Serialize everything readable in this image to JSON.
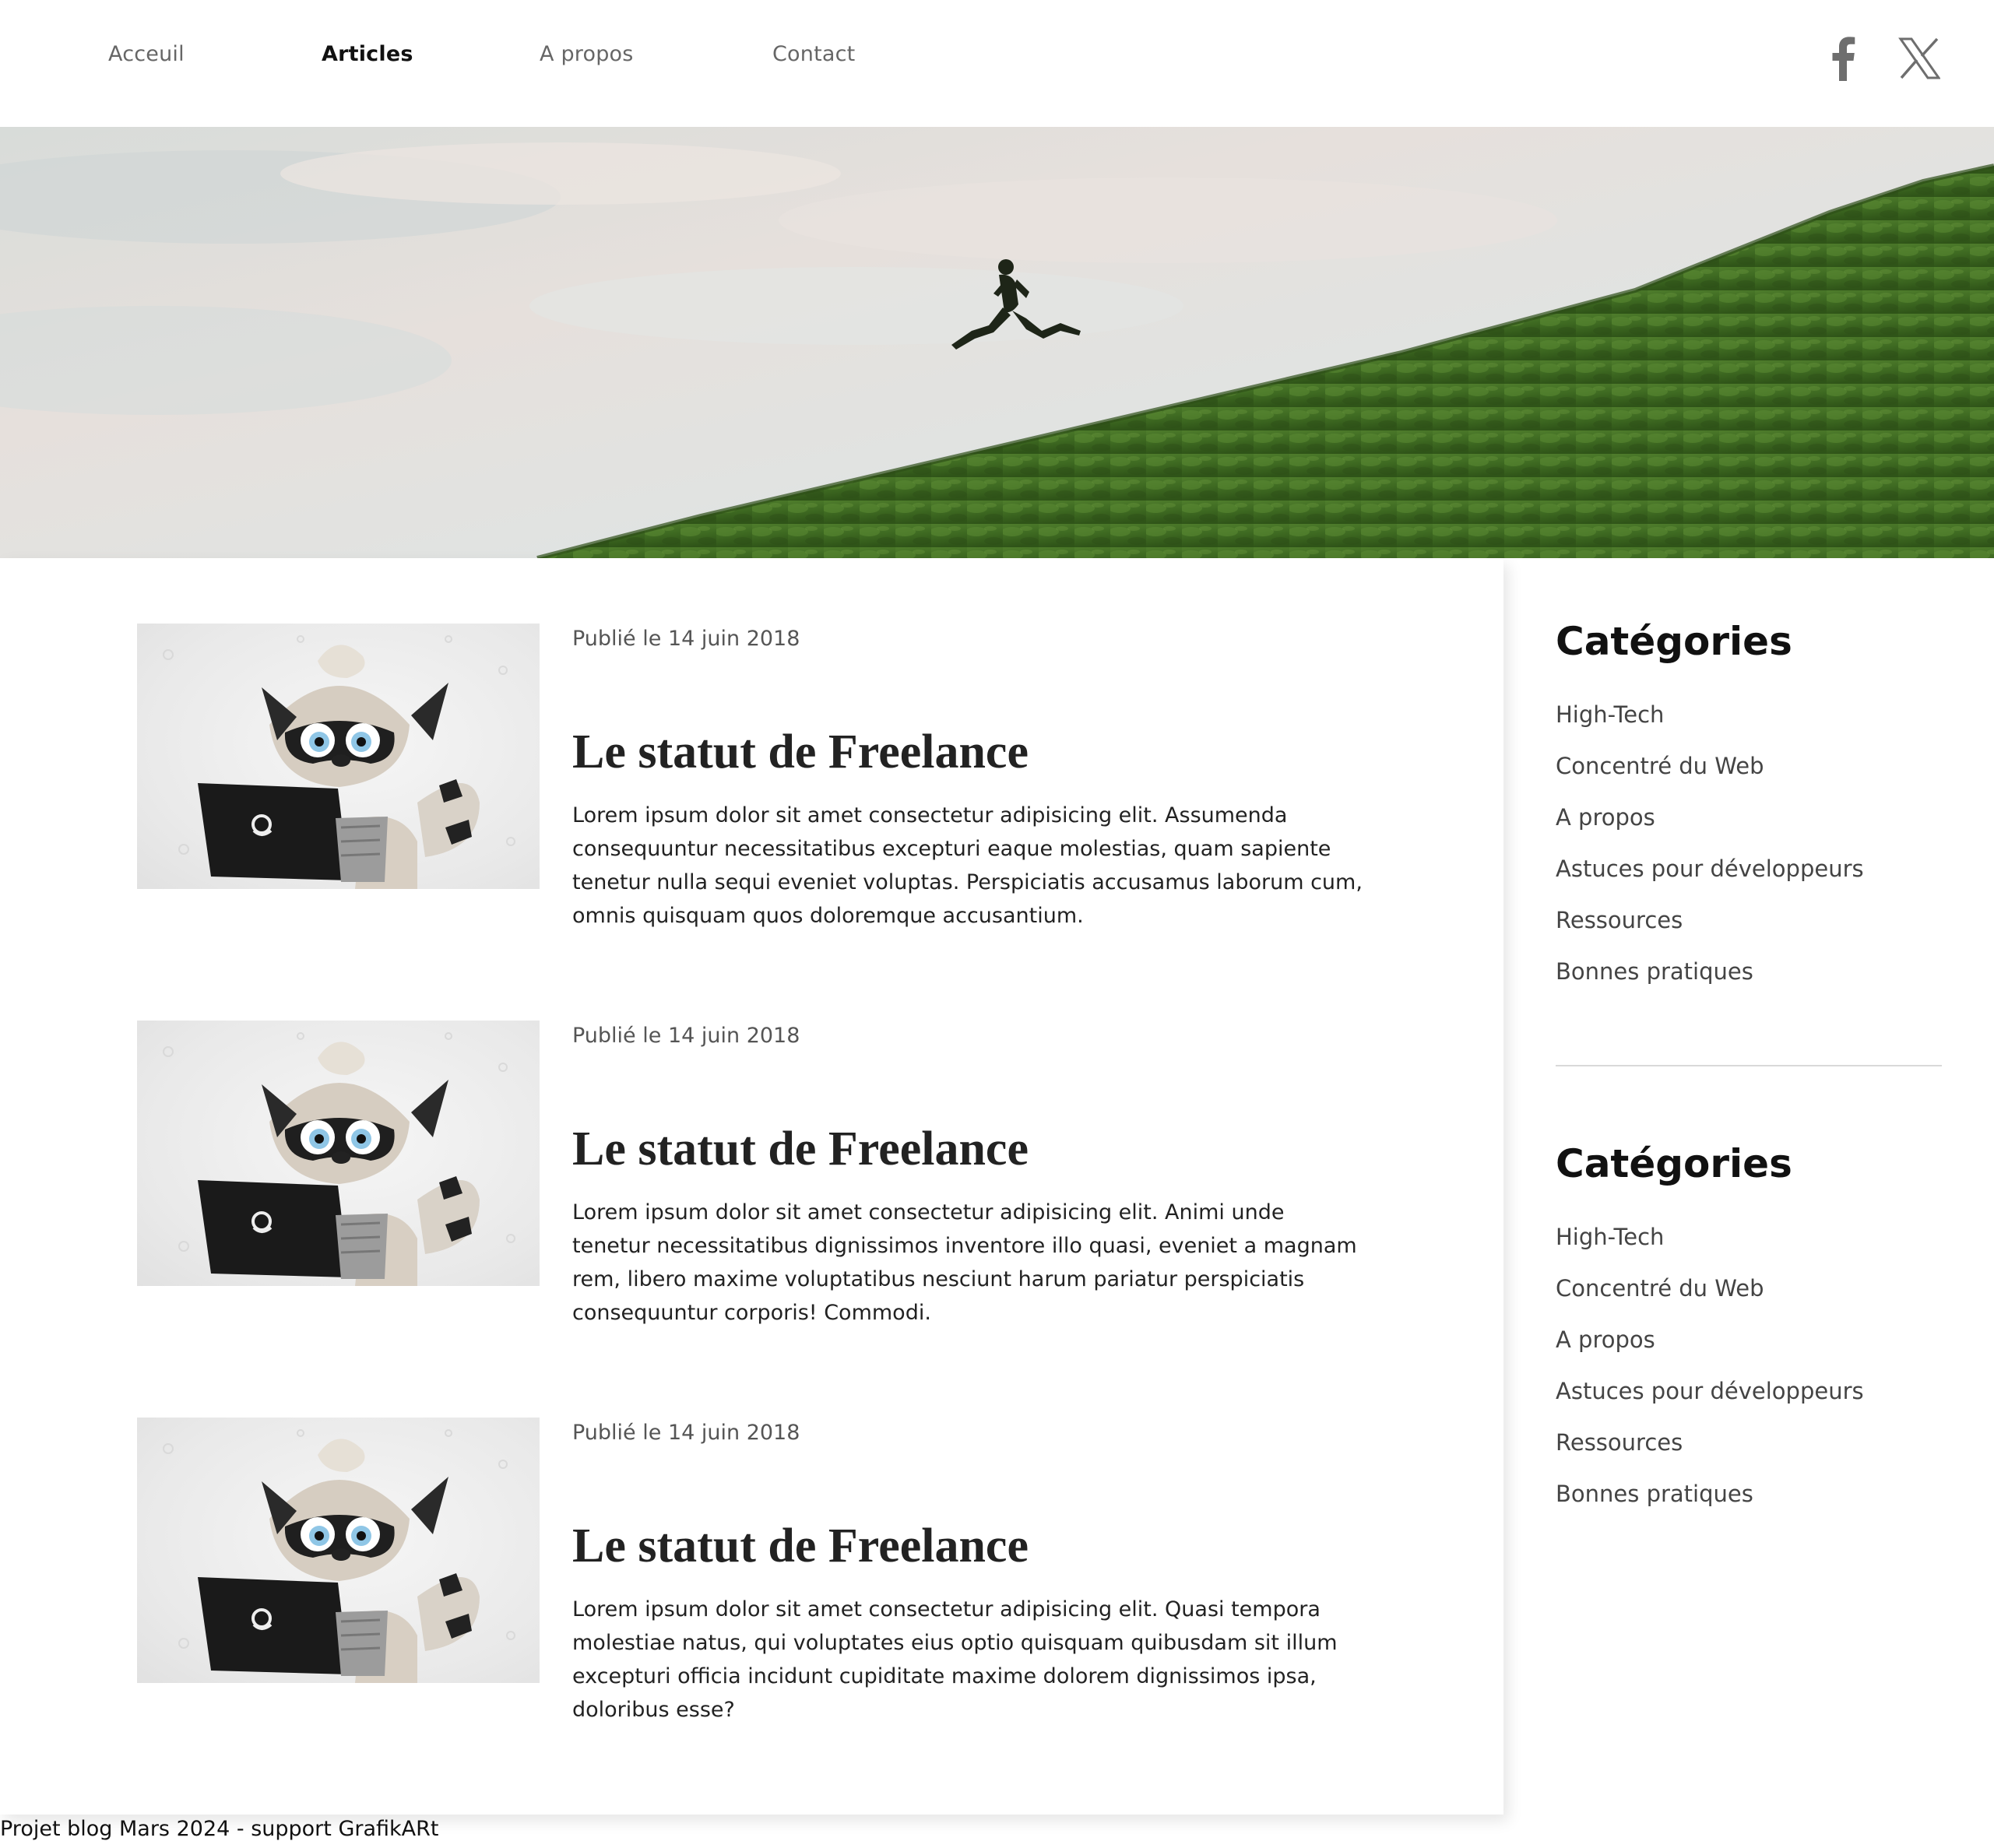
{
  "nav": {
    "items": [
      {
        "label": "Acceuil",
        "active": false
      },
      {
        "label": "Articles",
        "active": true
      },
      {
        "label": "A propos",
        "active": false
      },
      {
        "label": "Contact",
        "active": false
      }
    ],
    "social": [
      {
        "icon": "facebook-icon"
      },
      {
        "icon": "x-twitter-icon"
      }
    ]
  },
  "hero": {
    "image": "person-jumping-grassy-hill"
  },
  "articles": [
    {
      "date": "Publié le 14 juin 2018",
      "title": "Le statut de Freelance",
      "excerpt": "Lorem ipsum dolor sit amet consectetur adipisicing elit. Assumenda consequuntur necessitatibus excepturi eaque molestias, quam sapiente tenetur nulla sequi eveniet voluptas. Perspiciatis accusamus laborum cum, omnis quisquam quos doloremque accusantium.",
      "thumbnail": "raccoon-laptop-illustration"
    },
    {
      "date": "Publié le 14 juin 2018",
      "title": "Le statut de Freelance",
      "excerpt": "Lorem ipsum dolor sit amet consectetur adipisicing elit. Animi unde tenetur necessitatibus dignissimos inventore illo quasi, eveniet a magnam rem, libero maxime voluptatibus nesciunt harum pariatur perspiciatis consequuntur corporis! Commodi.",
      "thumbnail": "raccoon-laptop-illustration"
    },
    {
      "date": "Publié le 14 juin 2018",
      "title": "Le statut de Freelance",
      "excerpt": "Lorem ipsum dolor sit amet consectetur adipisicing elit. Quasi tempora molestiae natus, qui voluptates eius optio quisquam quibusdam sit illum excepturi officia incidunt cupiditate maxime dolorem dignissimos ipsa, doloribus esse?",
      "thumbnail": "raccoon-laptop-illustration"
    }
  ],
  "sidebar": {
    "blocks": [
      {
        "title": "Catégories",
        "items": [
          "High-Tech",
          "Concentré du Web",
          "A propos",
          "Astuces pour développeurs",
          "Ressources",
          "Bonnes pratiques"
        ]
      },
      {
        "title": "Catégories",
        "items": [
          "High-Tech",
          "Concentré du Web",
          "A propos",
          "Astuces pour développeurs",
          "Ressources",
          "Bonnes pratiques"
        ]
      }
    ]
  },
  "footer": {
    "text": "Projet blog Mars 2024 - support GrafikARt"
  },
  "colors": {
    "text_primary": "#222222",
    "text_muted": "#555555",
    "grass": "#3f6b22",
    "sky": "#dfe3e2"
  }
}
